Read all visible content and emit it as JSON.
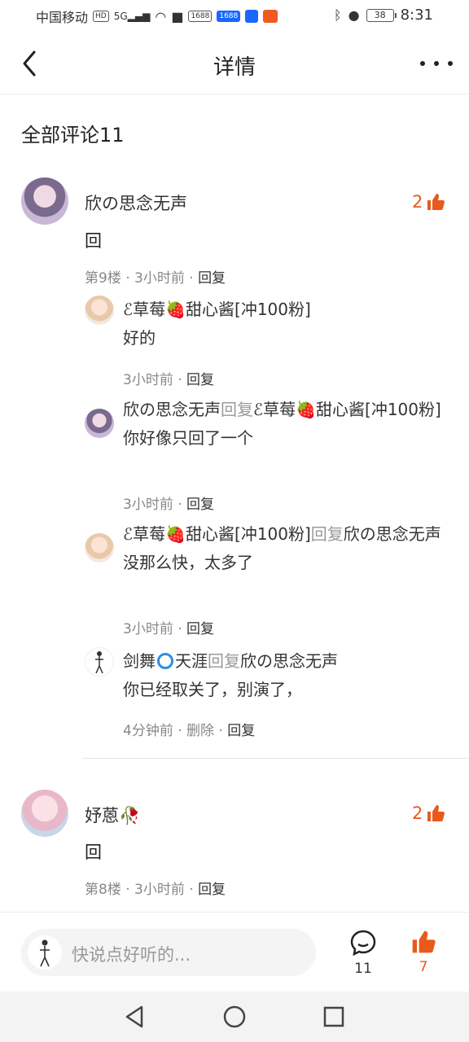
{
  "status_bar": {
    "carrier": "中国移动",
    "hd": "HD",
    "net": "5G",
    "badge1": "1688",
    "badge2": "1688",
    "battery": "38",
    "time": "8:31"
  },
  "nav": {
    "title": "详情"
  },
  "section_title": "全部评论11",
  "comments": [
    {
      "author": "欣の思念无声",
      "likes": "2",
      "text": "回",
      "meta": "第9楼 · 3小时前 · ",
      "reply_label": "回复",
      "replies": [
        {
          "line1": "ℰ草莓🍓甜心酱[冲100粉]",
          "line2": "好的",
          "meta": "3小时前 · ",
          "reply_label": "回复"
        },
        {
          "line1a": "欣の思念无声",
          "reply_word": "回复",
          "line1b": "ℰ草莓🍓甜心酱[冲100粉]",
          "line2": "你好像只回了一个",
          "meta": "3小时前 · ",
          "reply_label": "回复"
        },
        {
          "line1a": "ℰ草莓🍓甜心酱[冲100粉]",
          "reply_word": "回复",
          "line1b": "欣の思念无声",
          "line2": "没那么快，太多了",
          "meta": "3小时前 · ",
          "reply_label": "回复"
        },
        {
          "line1a": "剑舞",
          "line1c": "天涯",
          "reply_word": "回复",
          "line1b": "欣の思念无声",
          "line2": "你已经取关了，别演了，",
          "meta": "4分钟前 · 删除 · ",
          "reply_label": "回复"
        }
      ]
    },
    {
      "author": "妤蒽🥀",
      "likes": "2",
      "text": "回",
      "meta": "第8楼 · 3小时前 · ",
      "reply_label": "回复"
    }
  ],
  "bottom": {
    "placeholder": "快说点好听的...",
    "comment_count": "11",
    "like_count": "7"
  },
  "colors": {
    "accent": "#e85a1c",
    "gray": "#888888"
  }
}
